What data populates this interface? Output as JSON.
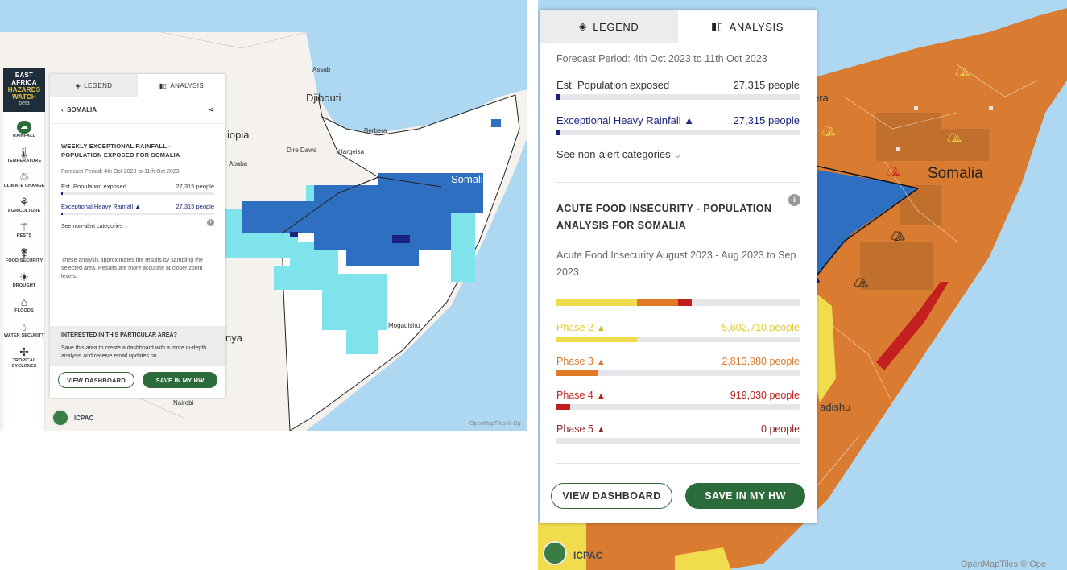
{
  "left": {
    "brand": {
      "line1": "EAST",
      "line2": "AFRICA",
      "line3": "HAZARDS",
      "line4": "WATCH",
      "beta": "beta"
    },
    "sidebar": [
      {
        "label": "RAINFALL",
        "icon": "rain-cloud-icon"
      },
      {
        "label": "TEMPERATURE",
        "icon": "thermometer-icon"
      },
      {
        "label": "CLIMATE CHANGE",
        "icon": "climate-icon"
      },
      {
        "label": "AGRICULTURE",
        "icon": "wheat-icon"
      },
      {
        "label": "PESTS",
        "icon": "locust-icon"
      },
      {
        "label": "FOOD SECURITY",
        "icon": "sprout-icon"
      },
      {
        "label": "DROUGHT",
        "icon": "sun-drought-icon"
      },
      {
        "label": "FLOODS",
        "icon": "flood-icon"
      },
      {
        "label": "WATER SECURITY",
        "icon": "drop-icon"
      },
      {
        "label": "TROPICAL CYCLONES",
        "icon": "cyclone-icon"
      }
    ],
    "tabs": {
      "legend": "LEGEND",
      "analysis": "ANALYSIS"
    },
    "breadcrumb": "SOMALIA",
    "title": "WEEKLY EXCEPTIONAL RAINFALL - POPULATION EXPOSED FOR SOMALIA",
    "forecast": "Forecast Period: 4th Oct 2023 to 11th Oct 2023",
    "exposed_label": "Est. Population exposed",
    "exposed_value": "27,315 people",
    "ehr_label": "Exceptional Heavy Rainfall",
    "ehr_value": "27,315 people",
    "see_more": "See non-alert categories",
    "note": "These analysis approximates the results by sampling the selected area. Results are more accurate at closer zoom levels.",
    "interest_title": "INTERESTED IN THIS PARTICULAR AREA?",
    "interest_body": "Save this area to create a dashboard with a more in-depth analysis and receive email updates on",
    "btn_dashboard": "VIEW DASHBOARD",
    "btn_save": "SAVE IN MY HW",
    "places": {
      "assab": "Assab",
      "djibouti": "Djibouti",
      "ethiopia": "iopia",
      "berbera": "Berbera",
      "diredawa": "Dire Dawa",
      "hargeisa": "Hargeisa",
      "ababa": "Ababa",
      "somalia": "Somalia",
      "mogadishu": "Mogadishu",
      "kenya": "nya",
      "nairobi": "Nairobi"
    },
    "icpac": "ICPAC",
    "omt": "OpenMapTiles © Op"
  },
  "right": {
    "tabs": {
      "legend": "LEGEND",
      "analysis": "ANALYSIS"
    },
    "forecast": "Forecast Period: 4th Oct 2023 to 11th Oct 2023",
    "exposed_label": "Est. Population exposed",
    "exposed_value": "27,315 people",
    "ehr_label": "Exceptional Heavy Rainfall",
    "ehr_value": "27,315 people",
    "see_more": "See non-alert categories",
    "afi_title": "ACUTE FOOD INSECURITY - POPULATION ANALYSIS FOR SOMALIA",
    "afi_sub": "Acute Food Insecurity August 2023 - Aug 2023 to Sep 2023",
    "stack": [
      {
        "value": 0.33,
        "color": "#f1dc4e"
      },
      {
        "value": 0.17,
        "color": "#e07a28"
      },
      {
        "value": 0.055,
        "color": "#c41f1f"
      }
    ],
    "phases": [
      {
        "label": "Phase 2",
        "value": "5,602,710 people",
        "fill": 0.33,
        "color": "#f1dc4e"
      },
      {
        "label": "Phase 3",
        "value": "2,813,980 people",
        "fill": 0.17,
        "color": "#e07a28"
      },
      {
        "label": "Phase 4",
        "value": "919,030 people",
        "fill": 0.055,
        "color": "#c41f1f"
      },
      {
        "label": "Phase 5",
        "value": "0 people",
        "fill": 0,
        "color": "#8a1f1f"
      }
    ],
    "btn_dashboard": "VIEW DASHBOARD",
    "btn_save": "SAVE IN MY HW",
    "places": {
      "era": "era",
      "somalia": "Somalia",
      "adishu": "adishu"
    },
    "icpac": "ICPAC",
    "omt": "OpenMapTiles © Ope"
  },
  "colors": {
    "accent_green": "#2c6b3a",
    "navy": "#1a237e",
    "phase2": "#d4b820",
    "phase3": "#e07a28",
    "phase4": "#c41f1f",
    "phase5": "#8a1f1f"
  }
}
